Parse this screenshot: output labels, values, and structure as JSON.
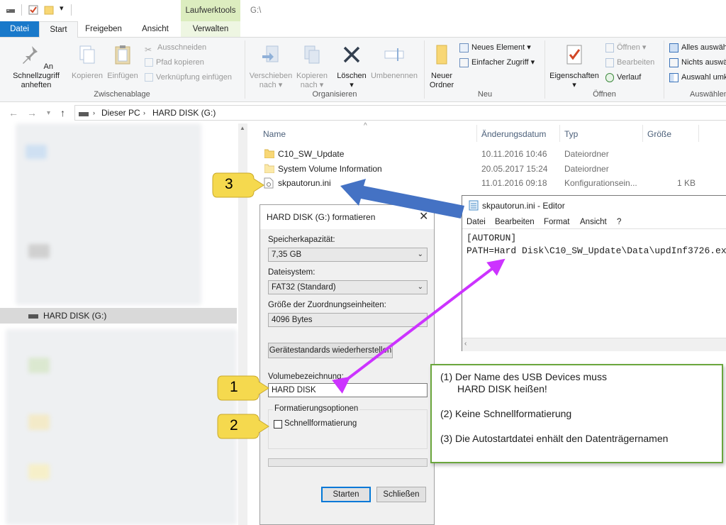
{
  "window": {
    "drive_path": "G:\\"
  },
  "tabs": {
    "datei": "Datei",
    "start": "Start",
    "freigeben": "Freigeben",
    "ansicht": "Ansicht",
    "context_group": "Laufwerktools",
    "verwalten": "Verwalten"
  },
  "ribbon": {
    "clipboard": {
      "pin": "An Schnellzugriff anheften",
      "copy": "Kopieren",
      "paste": "Einfügen",
      "cut": "Ausschneiden",
      "copy_path": "Pfad kopieren",
      "paste_shortcut": "Verknüpfung einfügen",
      "group": "Zwischenablage"
    },
    "organize": {
      "move_to": "Verschieben nach",
      "copy_to": "Kopieren nach",
      "delete": "Löschen",
      "rename": "Umbenennen",
      "group": "Organisieren"
    },
    "new": {
      "new_folder": "Neuer Ordner",
      "new_item": "Neues Element",
      "easy_access": "Einfacher Zugriff",
      "group": "Neu"
    },
    "open": {
      "properties": "Eigenschaften",
      "open": "Öffnen",
      "edit": "Bearbeiten",
      "history": "Verlauf",
      "group": "Öffnen"
    },
    "select": {
      "select_all": "Alles auswählen",
      "select_none": "Nichts auswählen",
      "invert": "Auswahl umkehren",
      "group": "Auswählen"
    }
  },
  "address": {
    "root": "Dieser PC",
    "drive": "HARD DISK (G:)"
  },
  "navpane": {
    "selected": "HARD DISK (G:)"
  },
  "filelist": {
    "headers": {
      "name": "Name",
      "date": "Änderungsdatum",
      "type": "Typ",
      "size": "Größe"
    },
    "rows": [
      {
        "name": "C10_SW_Update",
        "date": "10.11.2016 10:46",
        "type": "Dateiordner",
        "size": ""
      },
      {
        "name": "System Volume Information",
        "date": "20.05.2017 15:24",
        "type": "Dateiordner",
        "size": ""
      },
      {
        "name": "skpautorun.ini",
        "date": "11.01.2016 09:18",
        "type": "Konfigurationsein...",
        "size": "1 KB"
      }
    ]
  },
  "format_dialog": {
    "title": "HARD DISK (G:) formatieren",
    "capacity_label": "Speicherkapazität:",
    "capacity_value": "7,35 GB",
    "fs_label": "Dateisystem:",
    "fs_value": "FAT32 (Standard)",
    "alloc_label": "Größe der Zuordnungseinheiten:",
    "alloc_value": "4096 Bytes",
    "restore_button": "Gerätestandards wiederherstellen",
    "volume_label": "Volumebezeichnung:",
    "volume_value": "HARD DISK",
    "options_label": "Formatierungsoptionen",
    "quick_format": "Schnellformatierung",
    "start_button": "Starten",
    "close_button": "Schließen"
  },
  "editor": {
    "title": "skpautorun.ini - Editor",
    "menu": [
      "Datei",
      "Bearbeiten",
      "Format",
      "Ansicht",
      "?"
    ],
    "line1": "[AUTORUN]",
    "line2": "PATH=Hard Disk\\C10_SW_Update\\Data\\updInf3726.ex"
  },
  "annotation": {
    "note1a": "(1) Der Name des USB Devices muss",
    "note1b": "HARD DISK heißen!",
    "note2": "(2) Keine Schnellformatierung",
    "note3": "(3) Die Autostartdatei enhält den Datenträgernamen",
    "bubble1": "1",
    "bubble2": "2",
    "bubble3": "3"
  },
  "colors": {
    "accent": "#1979ca",
    "arrow_blue": "#4472c4",
    "arrow_magenta": "#cc33ff",
    "bubble": "#f5d94e",
    "note_border": "#6aa63c"
  }
}
